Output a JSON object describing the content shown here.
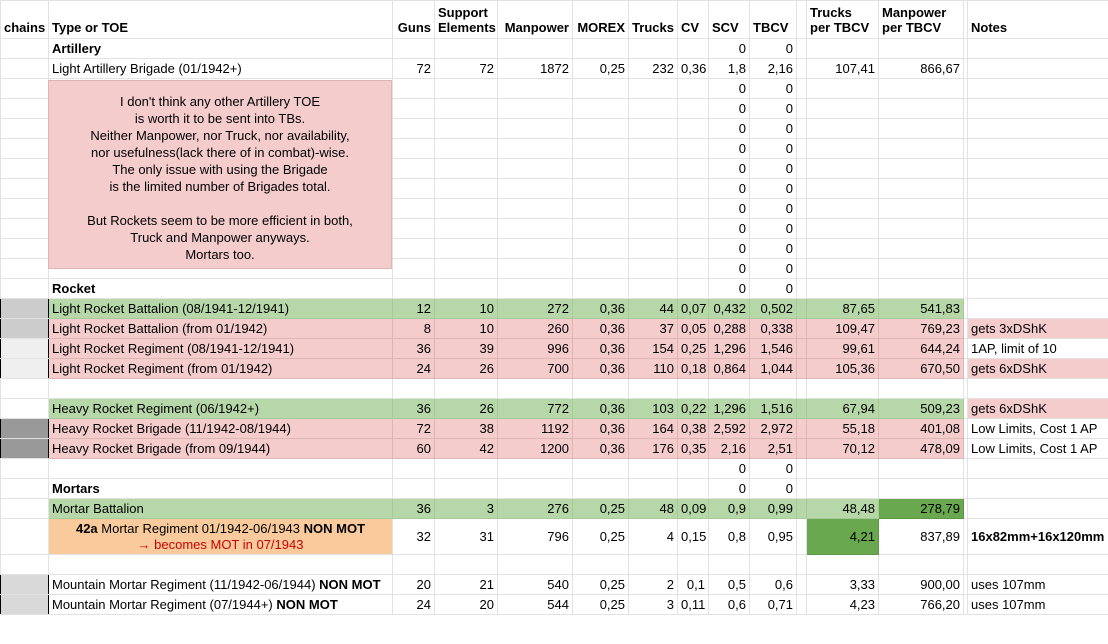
{
  "headers": [
    "chains",
    "Type or TOE",
    "Guns",
    "Support Elements",
    "Manpower",
    "MOREX",
    "Trucks",
    "CV",
    "SCV",
    "TBCV",
    "",
    "Trucks per TBCV",
    "Manpower per TBCV",
    "",
    "Notes"
  ],
  "note_lines": [
    "I don't think any other Artillery TOE",
    "is worth it to be sent into TBs.",
    "Neither Manpower, nor Truck, nor availability,",
    "nor usefulness(lack there of in combat)-wise.",
    "The only issue with using the Brigade",
    "is the limited number of Brigades total.",
    "",
    "But Rockets seem to be more efficient in both,",
    "Truck and Manpower anyways.",
    "Mortars too."
  ],
  "colors": {
    "green": "#b6d7a8",
    "dark_green": "#6aa84f",
    "pink": "#f4cccc",
    "orange": "#f9cb9c",
    "red": "#cc0000"
  },
  "rows": [
    {
      "type": [
        {
          "t": "Artillery",
          "b": true
        }
      ],
      "cells": [
        "",
        "",
        "",
        "",
        "",
        "",
        "0",
        "0",
        "",
        ""
      ]
    },
    {
      "type": [
        {
          "t": "Light Artillery Brigade (01/1942+)"
        }
      ],
      "cells": [
        "72",
        "72",
        "1872",
        "0,25",
        "232",
        "0,36",
        "1,8",
        "2,16",
        "107,41",
        "866,67"
      ]
    },
    {
      "type": [],
      "cells": [
        "",
        "",
        "",
        "",
        "",
        "",
        "0",
        "0",
        "",
        ""
      ]
    },
    {
      "type": [],
      "cells": [
        "",
        "",
        "",
        "",
        "",
        "",
        "0",
        "0",
        "",
        ""
      ]
    },
    {
      "type": [],
      "cells": [
        "",
        "",
        "",
        "",
        "",
        "",
        "0",
        "0",
        "",
        ""
      ]
    },
    {
      "type": [],
      "cells": [
        "",
        "",
        "",
        "",
        "",
        "",
        "0",
        "0",
        "",
        ""
      ]
    },
    {
      "type": [],
      "cells": [
        "",
        "",
        "",
        "",
        "",
        "",
        "0",
        "0",
        "",
        ""
      ]
    },
    {
      "type": [],
      "cells": [
        "",
        "",
        "",
        "",
        "",
        "",
        "0",
        "0",
        "",
        ""
      ]
    },
    {
      "type": [],
      "cells": [
        "",
        "",
        "",
        "",
        "",
        "",
        "0",
        "0",
        "",
        ""
      ]
    },
    {
      "type": [],
      "cells": [
        "",
        "",
        "",
        "",
        "",
        "",
        "0",
        "0",
        "",
        ""
      ]
    },
    {
      "type": [],
      "cells": [
        "",
        "",
        "",
        "",
        "",
        "",
        "0",
        "0",
        "",
        ""
      ]
    },
    {
      "type": [],
      "cells": [
        "",
        "",
        "",
        "",
        "",
        "",
        "0",
        "0",
        "",
        ""
      ]
    },
    {
      "type": [
        {
          "t": "Rocket",
          "b": true
        }
      ],
      "cells": [
        "",
        "",
        "",
        "",
        "",
        "",
        "0",
        "0",
        "",
        ""
      ]
    },
    {
      "type": [
        {
          "t": "Light Rocket Battalion (08/1941-12/1941)"
        }
      ],
      "style": "green",
      "chain": "#cccccc",
      "cells": [
        "12",
        "10",
        "272",
        "0,36",
        "44",
        "0,07",
        "0,432",
        "0,502",
        "87,65",
        "541,83"
      ],
      "notes": ""
    },
    {
      "type": [
        {
          "t": "Light Rocket Battalion (from 01/1942)"
        }
      ],
      "style": "pink",
      "chain": "#cccccc",
      "cells": [
        "8",
        "10",
        "260",
        "0,36",
        "37",
        "0,05",
        "0,288",
        "0,338",
        "109,47",
        "769,23"
      ],
      "notes": "gets 3xDShK",
      "notesBg": "#f4cccc"
    },
    {
      "type": [
        {
          "t": "Light Rocket Regiment (08/1941-12/1941)"
        }
      ],
      "style": "pink",
      "chain": "#efefef",
      "cells": [
        "36",
        "39",
        "996",
        "0,36",
        "154",
        "0,25",
        "1,296",
        "1,546",
        "99,61",
        "644,24"
      ],
      "notes": "1AP, limit of 10"
    },
    {
      "type": [
        {
          "t": "Light Rocket Regiment (from 01/1942)"
        }
      ],
      "style": "pink",
      "chain": "#efefef",
      "cells": [
        "24",
        "26",
        "700",
        "0,36",
        "110",
        "0,18",
        "0,864",
        "1,044",
        "105,36",
        "670,50"
      ],
      "notes": "gets 6xDShK",
      "notesBg": "#f4cccc"
    },
    {
      "type": [],
      "cells": [
        "",
        "",
        "",
        "",
        "",
        "",
        "",
        "",
        "",
        ""
      ]
    },
    {
      "type": [
        {
          "t": "Heavy Rocket Regiment (06/1942+)"
        }
      ],
      "style": "green",
      "cells": [
        "36",
        "26",
        "772",
        "0,36",
        "103",
        "0,22",
        "1,296",
        "1,516",
        "67,94",
        "509,23"
      ],
      "notes": "gets 6xDShK",
      "notesBg": "#f4cccc"
    },
    {
      "type": [
        {
          "t": "Heavy Rocket Brigade (11/1942-08/1944)"
        }
      ],
      "style": "pink",
      "chain": "#999999",
      "cells": [
        "72",
        "38",
        "1192",
        "0,36",
        "164",
        "0,38",
        "2,592",
        "2,972",
        "55,18",
        "401,08"
      ],
      "notes": "Low Limits, Cost 1 AP"
    },
    {
      "type": [
        {
          "t": "Heavy Rocket Brigade (from 09/1944)"
        }
      ],
      "style": "pink",
      "chain": "#999999",
      "cells": [
        "60",
        "42",
        "1200",
        "0,36",
        "176",
        "0,35",
        "2,16",
        "2,51",
        "70,12",
        "478,09"
      ],
      "notes": "Low Limits, Cost 1 AP"
    },
    {
      "type": [],
      "cells": [
        "",
        "",
        "",
        "",
        "",
        "",
        "0",
        "0",
        "",
        ""
      ]
    },
    {
      "type": [
        {
          "t": "Mortars",
          "b": true
        }
      ],
      "cells": [
        "",
        "",
        "",
        "",
        "",
        "",
        "0",
        "0",
        "",
        ""
      ]
    },
    {
      "type": [
        {
          "t": "Mortar Battalion"
        }
      ],
      "style": "green",
      "cells": [
        "36",
        "3",
        "276",
        "0,25",
        "48",
        "0,09",
        "0,9",
        "0,99",
        "48,48",
        "278,79"
      ],
      "dark": [
        9
      ]
    },
    {
      "type": [
        {
          "t": "42a",
          "b": true
        },
        {
          "t": " Mortar Regiment 01/1942-06/1943 "
        },
        {
          "t": "NON MOT",
          "b": true
        },
        {
          "t": "→ becomes MOT in 07/1943",
          "br": true,
          "red": true
        }
      ],
      "tall": true,
      "typeBg": "#f9cb9c",
      "cells": [
        "32",
        "31",
        "796",
        "0,25",
        "4",
        "0,15",
        "0,8",
        "0,95",
        "4,21",
        "837,89"
      ],
      "dark": [
        8
      ],
      "notes": "16x82mm+16x120mm",
      "notesBold": true
    },
    {
      "type": [],
      "cells": [
        "",
        "",
        "",
        "",
        "",
        "",
        "",
        "",
        "",
        ""
      ]
    },
    {
      "type": [
        {
          "t": "Mountain Mortar Regiment (11/1942-06/1944) "
        },
        {
          "t": "NON MOT",
          "b": true
        }
      ],
      "chain": "#d9d9d9",
      "cells": [
        "20",
        "21",
        "540",
        "0,25",
        "2",
        "0,1",
        "0,5",
        "0,6",
        "3,33",
        "900,00"
      ],
      "notes": "uses 107mm"
    },
    {
      "type": [
        {
          "t": "Mountain Mortar Regiment (07/1944+) "
        },
        {
          "t": "NON MOT",
          "b": true
        }
      ],
      "chain": "#d9d9d9",
      "cells": [
        "24",
        "20",
        "544",
        "0,25",
        "3",
        "0,11",
        "0,6",
        "0,71",
        "4,23",
        "766,20"
      ],
      "notes": "uses 107mm"
    }
  ]
}
